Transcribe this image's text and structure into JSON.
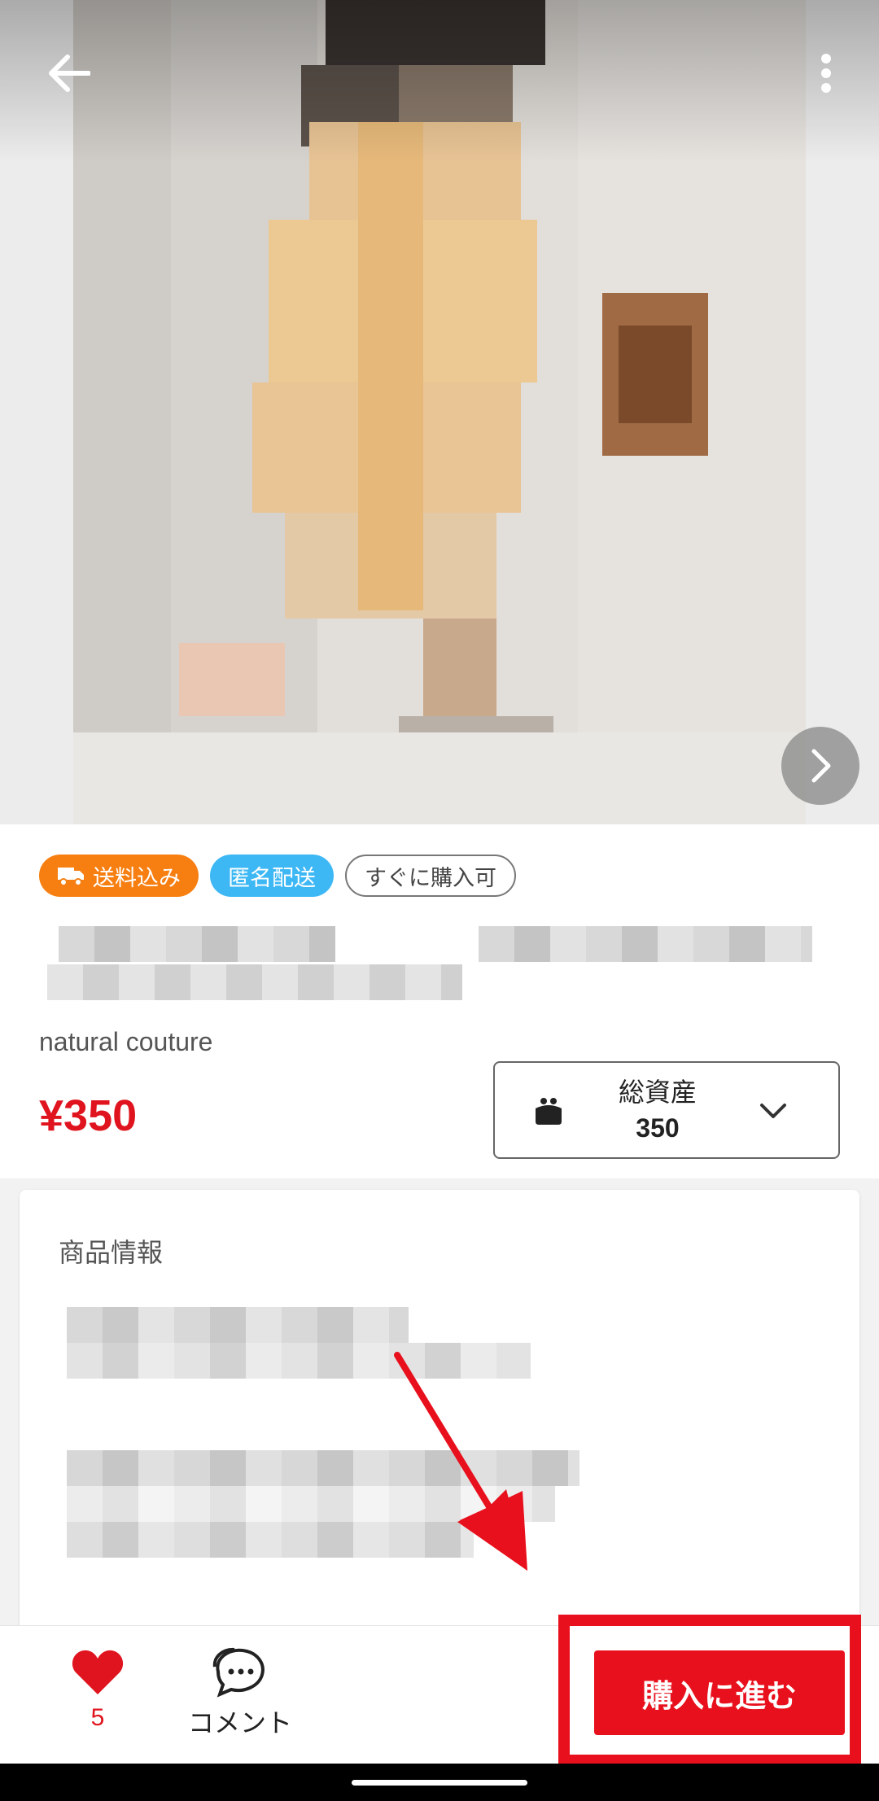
{
  "product": {
    "tags": {
      "shipping_included": "送料込み",
      "anonymous_shipping": "匿名配送",
      "instant_purchase": "すぐに購入可"
    },
    "brand": "natural couture",
    "price": "¥350"
  },
  "assets": {
    "label": "総資産",
    "value": "350"
  },
  "info": {
    "heading": "商品情報"
  },
  "bottom_bar": {
    "like_count": "5",
    "comment_label": "コメント",
    "buy_label": "購入に進む"
  },
  "colors": {
    "accent_red": "#e8101c",
    "price_red": "#e0141e",
    "shipping_tag": "#f77f12",
    "anonymous_tag": "#3db8f5"
  },
  "icons": {
    "back": "back-arrow-icon",
    "more": "more-vertical-icon",
    "next": "chevron-right-icon",
    "truck": "truck-icon",
    "purse": "purse-icon",
    "dropdown": "chevron-down-icon",
    "like": "heart-icon",
    "comment": "comment-icon"
  }
}
